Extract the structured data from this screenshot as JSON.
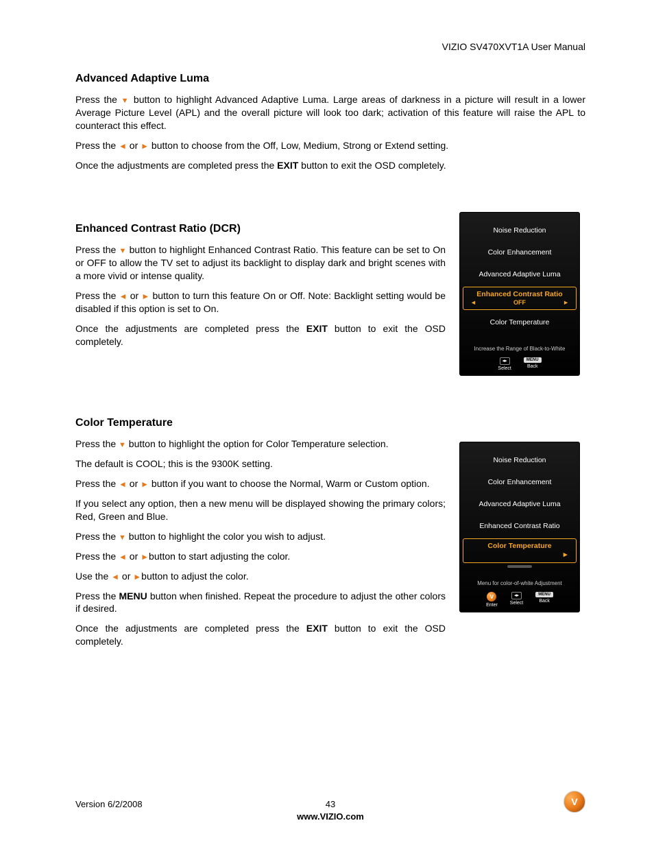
{
  "header": {
    "title": "VIZIO SV470XVT1A User Manual"
  },
  "sections": {
    "adaptive_luma": {
      "title": "Advanced Adaptive Luma",
      "p1a": "Press the ",
      "p1b": " button to highlight Advanced Adaptive Luma. Large areas of darkness in a picture will result in a lower Average Picture Level (APL) and the overall picture will look too dark; activation of this feature will raise the APL to counteract this effect.",
      "p2a": "Press the ",
      "p2mid": " or ",
      "p2b": " button to choose from the Off, Low, Medium, Strong or Extend setting.",
      "p3a": "Once the adjustments are completed press the ",
      "p3bold": "EXIT",
      "p3b": " button to exit the OSD completely."
    },
    "dcr": {
      "title": "Enhanced Contrast Ratio (DCR)",
      "p1a": "Press the ",
      "p1b": " button to highlight Enhanced Contrast Ratio.  This feature can be set to On or OFF to allow the TV set to adjust its backlight to display dark and bright scenes with a more vivid or intense quality.",
      "p2a": "Press the ",
      "p2mid": " or ",
      "p2b": " button to turn this feature On or Off. Note: Backlight setting would be disabled if this option is set to On.",
      "p3a": "Once the adjustments are completed press the ",
      "p3bold": "EXIT",
      "p3b": " button to exit the OSD completely."
    },
    "color_temp": {
      "title": "Color Temperature",
      "p1a": "Press the ",
      "p1b": " button to highlight the option for Color Temperature selection.",
      "p2": "The default is COOL; this is the 9300K setting.",
      "p3a": "Press the ",
      "p3mid": " or ",
      "p3b": " button if you want to choose the Normal, Warm or Custom option.",
      "p4": "If you select any option, then a new menu will be displayed showing the primary colors; Red, Green and Blue.",
      "p5a": "Press the ",
      "p5b": " button to highlight the color you wish to adjust.",
      "p6a": "Press the ",
      "p6mid": " or ",
      "p6b": "button to start adjusting the color.",
      "p7a": "Use the ",
      "p7mid": " or ",
      "p7b": "button to adjust the color.",
      "p8a": "Press the ",
      "p8bold": "MENU",
      "p8b": " button when finished.  Repeat the procedure to adjust the other colors if desired.",
      "p9a": "Once the adjustments are completed press the ",
      "p9bold": "EXIT",
      "p9b": " button to exit the OSD completely."
    }
  },
  "osd1": {
    "items": [
      "Noise Reduction",
      "Color Enhancement",
      "Advanced Adaptive Luma"
    ],
    "highlight": "Enhanced Contrast Ratio",
    "highlight_value": "OFF",
    "after": [
      "Color Temperature"
    ],
    "hint": "Increase the Range of Black-to-White",
    "footer": {
      "select": "Select",
      "back": "Back",
      "menu": "MENU"
    }
  },
  "osd2": {
    "items": [
      "Noise Reduction",
      "Color Enhancement",
      "Advanced Adaptive Luma",
      "Enhanced Contrast Ratio"
    ],
    "highlight": "Color Temperature",
    "hint": "Menu for color-of-white Adjustment",
    "footer": {
      "enter": "Enter",
      "select": "Select",
      "back": "Back",
      "menu": "MENU"
    }
  },
  "footer": {
    "version": "Version 6/2/2008",
    "page": "43",
    "url": "www.VIZIO.com"
  },
  "logo_letter": "V"
}
